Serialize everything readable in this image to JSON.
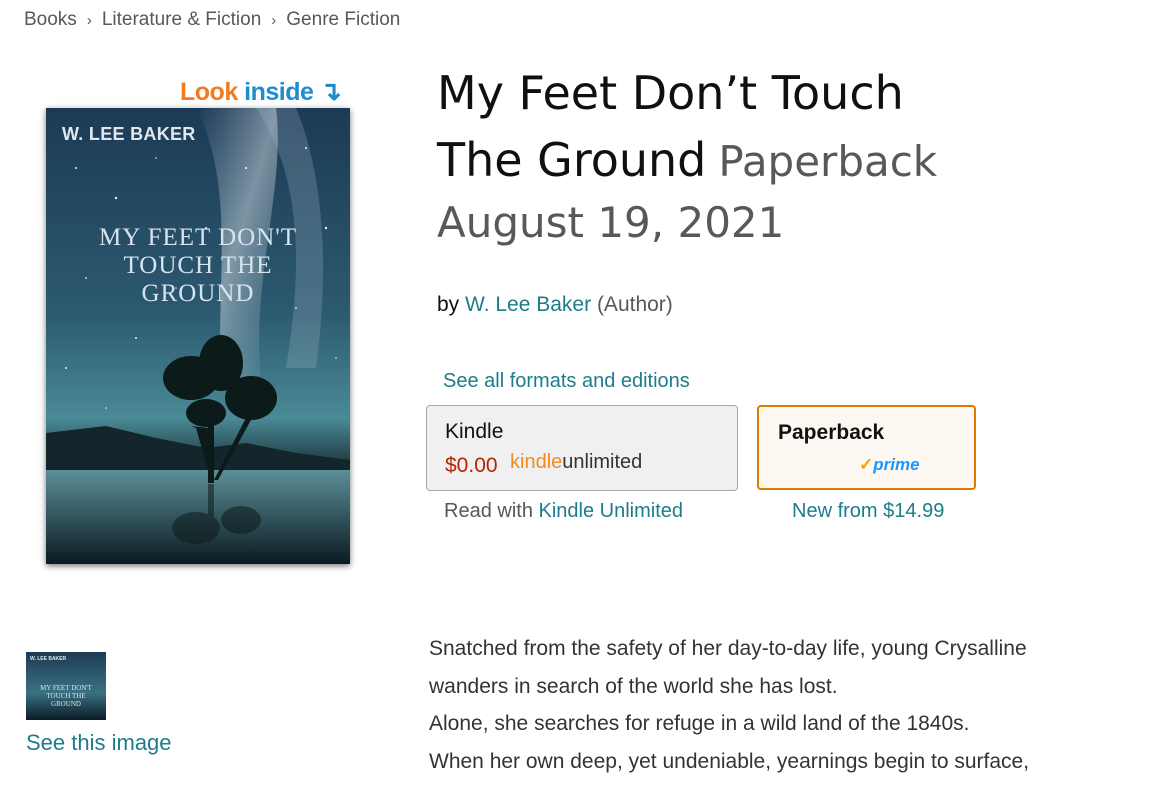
{
  "breadcrumb": [
    "Books",
    "Literature & Fiction",
    "Genre Fiction"
  ],
  "look_inside": {
    "look": "Look",
    "inside": "inside",
    "arrow": "↴"
  },
  "cover": {
    "author": "W. LEE BAKER",
    "title": "MY FEET DON'T\nTOUCH THE\nGROUND"
  },
  "thumbnail": {
    "author": "W. LEE BAKER",
    "title": "MY FEET DON'T\nTOUCH THE\nGROUND",
    "link_label": "See this image"
  },
  "product": {
    "title_line1": "My Feet Don’t Touch",
    "title_line2": "The Ground",
    "format": "Paperback",
    "date": "August 19, 2021",
    "by": "by",
    "author": "W. Lee Baker",
    "role": "(Author)"
  },
  "formats": {
    "link": "See all formats and editions",
    "kindle": {
      "name": "Kindle",
      "price": "$0.00",
      "ku_logo_a": "kindle",
      "ku_logo_b": "unlimited",
      "sub_prefix": "Read with",
      "sub_link": "Kindle Unlimited"
    },
    "paperback": {
      "name": "Paperback",
      "prime": "prime",
      "prime_check": "✓",
      "sub_prefix": "New from",
      "sub_price": "$14.99"
    }
  },
  "description": [
    "Snatched from the safety of her day-to-day life, young Crysalline",
    "wanders in search of the world she has lost.",
    "Alone, she searches for refuge in a wild land of the 1840s.",
    "When her own deep, yet undeniable, yearnings begin to surface,"
  ],
  "colors": {
    "link": "#1d7c8c",
    "price": "#b12704",
    "selected_border": "#e77600",
    "look": "#f47a20",
    "inside": "#1a8ccf"
  }
}
